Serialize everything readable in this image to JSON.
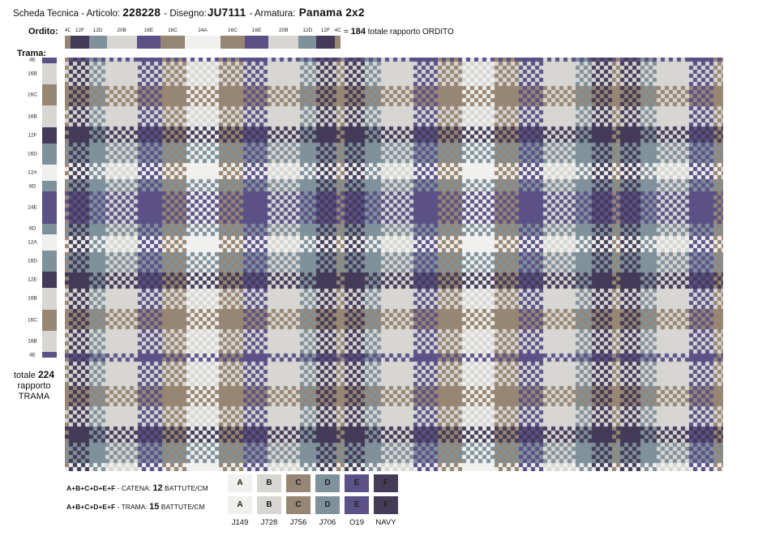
{
  "header": {
    "prefix": "Scheda Tecnica - Articolo:",
    "articolo": "228228",
    "disegno_label": "- Disegno:",
    "disegno": "JU7111",
    "armatura_label": "- Armatura:",
    "armatura": "Panama 2x2"
  },
  "colors": {
    "A": "#f0f0ee",
    "B": "#d7d6d3",
    "C": "#978673",
    "D": "#7f919b",
    "E": "#5b5187",
    "F": "#433b58"
  },
  "warp": {
    "label": "Ordito:",
    "segments": [
      {
        "label": "4C",
        "color": "C",
        "count": 4
      },
      {
        "label": "12F",
        "color": "F",
        "count": 12
      },
      {
        "label": "12D",
        "color": "D",
        "count": 12
      },
      {
        "label": "20B",
        "color": "B",
        "count": 20
      },
      {
        "label": "16E",
        "color": "E",
        "count": 16
      },
      {
        "label": "16C",
        "color": "C",
        "count": 16
      },
      {
        "label": "24A",
        "color": "A",
        "count": 24
      },
      {
        "label": "16C",
        "color": "C",
        "count": 16
      },
      {
        "label": "16E",
        "color": "E",
        "count": 16
      },
      {
        "label": "20B",
        "color": "B",
        "count": 20
      },
      {
        "label": "12D",
        "color": "D",
        "count": 12
      },
      {
        "label": "12F",
        "color": "F",
        "count": 12
      },
      {
        "label": "4C",
        "color": "C",
        "count": 4
      }
    ],
    "total_eq": "=",
    "total": "184",
    "total_text": "totale rapporto ORDITO"
  },
  "weft": {
    "label": "Trama:",
    "segments": [
      {
        "label": "4E",
        "color": "E",
        "count": 4
      },
      {
        "label": "16B",
        "color": "B",
        "count": 16
      },
      {
        "label": "16C",
        "color": "C",
        "count": 16
      },
      {
        "label": "16B",
        "color": "B",
        "count": 16
      },
      {
        "label": "12F",
        "color": "F",
        "count": 12
      },
      {
        "label": "16D",
        "color": "D",
        "count": 16
      },
      {
        "label": "12A",
        "color": "A",
        "count": 12
      },
      {
        "label": "8D",
        "color": "D",
        "count": 8
      },
      {
        "label": "24E",
        "color": "E",
        "count": 24
      },
      {
        "label": "8D",
        "color": "D",
        "count": 8
      },
      {
        "label": "12A",
        "color": "A",
        "count": 12
      },
      {
        "label": "16D",
        "color": "D",
        "count": 16
      },
      {
        "label": "12E",
        "color": "F",
        "count": 12
      },
      {
        "label": "16B",
        "color": "B",
        "count": 16
      },
      {
        "label": "16C",
        "color": "C",
        "count": 16
      },
      {
        "label": "16B",
        "color": "B",
        "count": 16
      },
      {
        "label": "4E",
        "color": "E",
        "count": 4
      }
    ],
    "total_prefix": "totale",
    "total": "224",
    "total_l2": "rapporto",
    "total_l3": "TRAMA"
  },
  "legend": {
    "catena_formula": "A+B+C+D+E+F",
    "catena_text": "- CATENA:",
    "catena_value": "12",
    "catena_unit": "BATTUTE/CM",
    "trama_formula": "A+B+C+D+E+F",
    "trama_text": "- TRAMA:",
    "trama_value": "15",
    "trama_unit": "BATTUTE/CM",
    "swatches": [
      {
        "letter": "A",
        "color": "A",
        "code": "J149"
      },
      {
        "letter": "B",
        "color": "B",
        "code": "J728"
      },
      {
        "letter": "C",
        "color": "C",
        "code": "J756"
      },
      {
        "letter": "D",
        "color": "D",
        "code": "J706"
      },
      {
        "letter": "E",
        "color": "E",
        "code": "O19"
      },
      {
        "letter": "F",
        "color": "F",
        "code": "NAVY"
      }
    ]
  }
}
